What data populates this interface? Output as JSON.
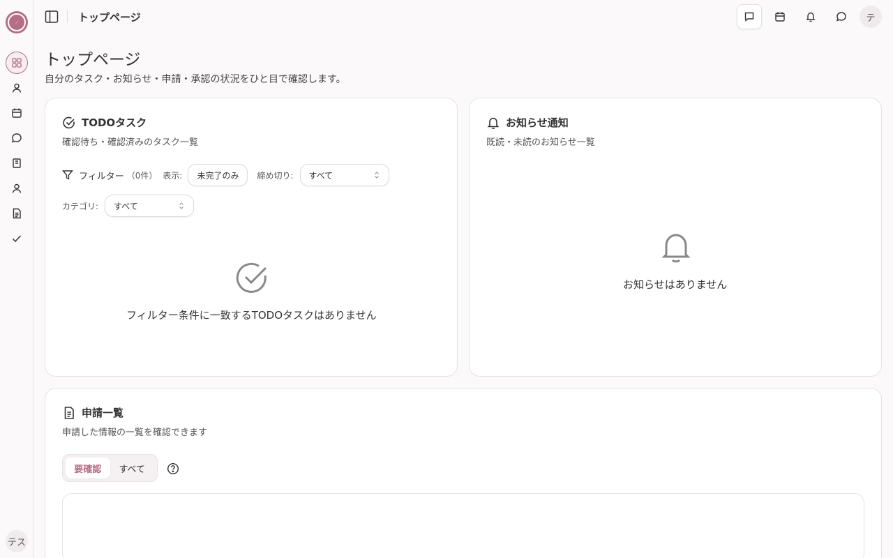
{
  "header": {
    "title": "トップページ",
    "avatar_initial": "テ"
  },
  "sidebar": {
    "avatar_label": "テス",
    "items": [
      {
        "icon": "dashboard-icon",
        "active": true
      },
      {
        "icon": "user-icon"
      },
      {
        "icon": "calendar-icon"
      },
      {
        "icon": "chat-icon"
      },
      {
        "icon": "book-icon"
      },
      {
        "icon": "person-icon"
      },
      {
        "icon": "document-icon"
      },
      {
        "icon": "check-icon"
      }
    ]
  },
  "page": {
    "title": "トップページ",
    "subtitle": "自分のタスク・お知らせ・申請・承認の状況をひと目で確認します。"
  },
  "todo": {
    "title": "TODOタスク",
    "subtitle": "確認待ち・確認済みのタスク一覧",
    "filter_label": "フィルター",
    "filter_count": "（0件）",
    "display_label": "表示:",
    "display_value": "未完了のみ",
    "deadline_label": "締め切り:",
    "deadline_value": "すべて",
    "category_label": "カテゴリ:",
    "category_value": "すべて",
    "empty_message": "フィルター条件に一致するTODOタスクはありません"
  },
  "notice": {
    "title": "お知らせ通知",
    "subtitle": "既読・未読のお知らせ一覧",
    "empty_message": "お知らせはありません"
  },
  "applications": {
    "title": "申請一覧",
    "subtitle": "申請した情報の一覧を確認できます",
    "tabs": [
      {
        "label": "要確認",
        "active": true
      },
      {
        "label": "すべて",
        "active": false
      }
    ]
  },
  "colors": {
    "accent": "#b46e85"
  }
}
